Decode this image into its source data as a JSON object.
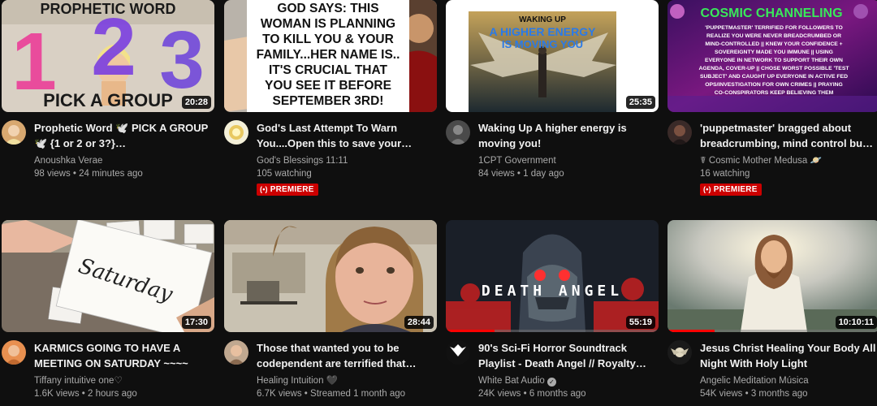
{
  "videos": [
    {
      "thumbnail_text": [
        "PROPHETIC WORD",
        "1",
        "2",
        "3",
        "PICK A GROUP"
      ],
      "duration": "20:28",
      "title": "Prophetic Word 🕊️ PICK A GROUP 🕊️ {1 or 2 or 3?}…",
      "channel": "Anoushka Verae",
      "stats": "98 views • 24 minutes ago"
    },
    {
      "thumbnail_text": [
        "GOD SAYS: THIS",
        "WOMAN IS PLANNING",
        "TO KILL YOU & YOUR",
        "FAMILY...HER NAME IS..",
        "IT'S CRUCIAL THAT",
        "YOU SEE IT BEFORE",
        "SEPTEMBER 3RD!"
      ],
      "title": "God's Last Attempt To Warn You....Open this to save your…",
      "channel": "God's Blessings 11:11",
      "stats": "105 watching",
      "badge": "PREMIERE"
    },
    {
      "thumbnail_text": [
        "WAKING UP",
        "A HIGHER ENERGY",
        "IS MOVING YOU"
      ],
      "duration": "25:35",
      "title": "Waking Up A higher energy is moving you!",
      "channel": "1CPT Government",
      "stats": "84 views • 1 day ago"
    },
    {
      "thumbnail_text": [
        "COSMIC CHANNELING",
        "'PUPPETMASTER' TERRIFIED FOR FOLLOWERS TO",
        "REALIZE YOU WERE NEVER BREADCRUMBED OR",
        "MIND-CONTROLLED || KNEW YOUR CONFIDENCE +",
        "SOVEREIGNTY MADE YOU IMMUNE || USING",
        "EVERYONE IN NETWORK TO SUPPORT THEIR OWN",
        "AGENDA, COVER-UP || CHOSE WORST POSSIBLE 'TEST",
        "SUBJECT' AND CAUGHT UP EVERYONE IN ACTIVE FED",
        "OPS/INVESTIGATION FOR OWN CRIMES || PRAYING",
        "CO-CONSPIRATORS KEEP BELIEVING THEM"
      ],
      "title": "'puppetmaster' bragged about breadcrumbing, mind control bu…",
      "channel": "☤ Cosmic Mother Medusa 🪐",
      "stats": "16 watching",
      "badge": "PREMIERE"
    },
    {
      "thumbnail_text": [
        "Saturday"
      ],
      "duration": "17:30",
      "title": "KARMICS GOING TO HAVE A MEETING ON SATURDAY ~~~~",
      "channel": "Tiffany intuitive one♡",
      "stats": "1.6K views • 2 hours ago"
    },
    {
      "duration": "28:44",
      "title": "Those that wanted you to be codependent are terrified that…",
      "channel": "Healing Intuition 🖤",
      "stats": "6.7K views • Streamed 1 month ago"
    },
    {
      "thumbnail_text": [
        "DEATH ANGEL"
      ],
      "duration": "55:19",
      "progress": 0.23,
      "title": "90's Sci-Fi Horror Soundtrack Playlist - Death Angel // Royalty…",
      "channel": "White Bat Audio",
      "verified": true,
      "stats": "24K views • 6 months ago"
    },
    {
      "duration": "10:10:11",
      "progress": 0.22,
      "title": "Jesus Christ Healing Your Body All Night With Holy Light",
      "channel": "Angelic Meditation Música",
      "stats": "54K views • 3 months ago"
    }
  ]
}
